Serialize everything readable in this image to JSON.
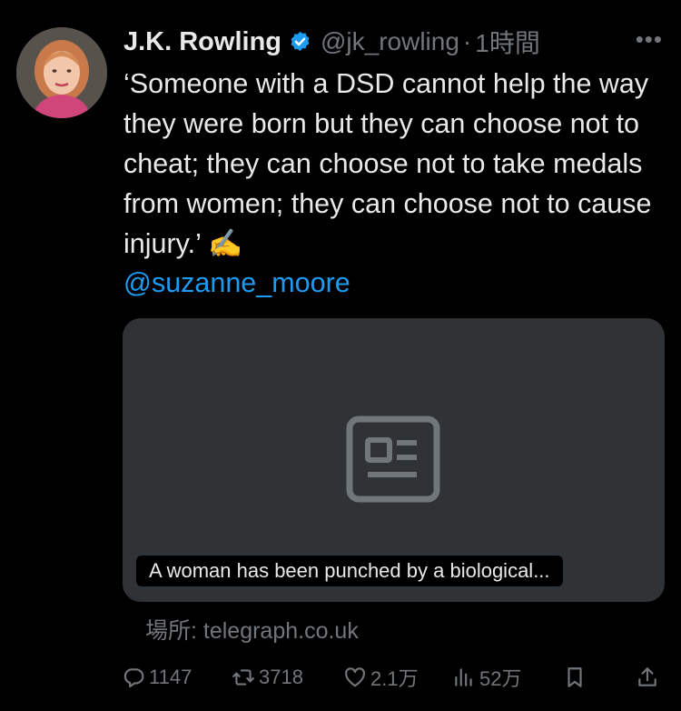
{
  "tweet": {
    "author_name": "J.K. Rowling",
    "handle": "@jk_rowling",
    "separator": "·",
    "time": "1時間",
    "more": "•••",
    "body": "‘Someone with a DSD cannot help the way they were born but they can choose not to cheat; they can choose not to take medals from women; they can choose not to cause injury.’ ✍️",
    "mention": "@suzanne_moore"
  },
  "card": {
    "caption": "A woman has been punched by a biological...",
    "source": "場所: telegraph.co.uk",
    "icon": "news-article-icon"
  },
  "actions": {
    "replies": "1147",
    "retweets": "3718",
    "likes": "2.1万",
    "views": "52万"
  },
  "colors": {
    "background": "#000000",
    "text": "#e7e9ea",
    "muted": "#71767b",
    "link": "#1d9bf0",
    "card": "#2f3336",
    "verified": "#1d9bf0"
  }
}
